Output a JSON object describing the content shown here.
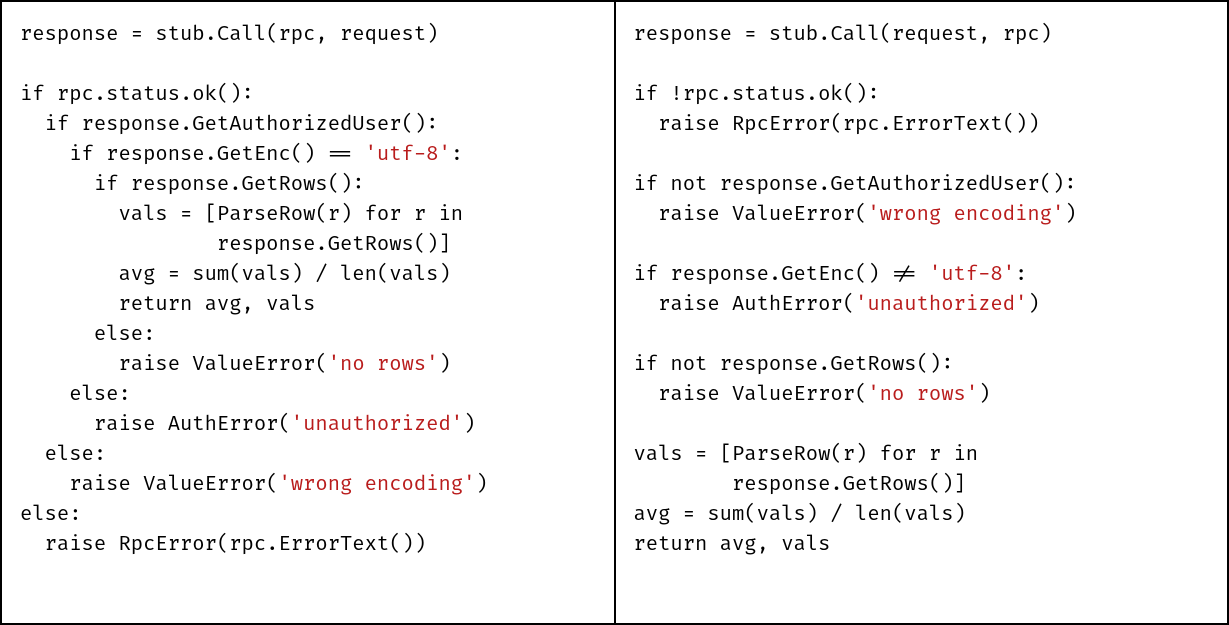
{
  "left": {
    "l1": "response = stub.Call(rpc, request)",
    "l2": "",
    "l3": "if rpc.status.ok():",
    "l4": "  if response.GetAuthorizedUser():",
    "l5a": "    if response.GetEnc() == ",
    "l5s": "'utf-8'",
    "l5b": ":",
    "l6": "      if response.GetRows():",
    "l7": "        vals = [ParseRow(r) for r in",
    "l8": "                response.GetRows()]",
    "l9": "        avg = sum(vals) / len(vals)",
    "l10": "        return avg, vals",
    "l11": "      else:",
    "l12a": "        raise ValueError(",
    "l12s": "'no rows'",
    "l12b": ")",
    "l13": "    else:",
    "l14a": "      raise AuthError(",
    "l14s": "'unauthorized'",
    "l14b": ")",
    "l15": "  else:",
    "l16a": "    raise ValueError(",
    "l16s": "'wrong encoding'",
    "l16b": ")",
    "l17": "else:",
    "l18": "  raise RpcError(rpc.ErrorText())"
  },
  "right": {
    "r1": "response = stub.Call(request, rpc)",
    "r2": "",
    "r3": "if !rpc.status.ok():",
    "r4": "  raise RpcError(rpc.ErrorText())",
    "r5": "",
    "r6": "if not response.GetAuthorizedUser():",
    "r7a": "  raise ValueError(",
    "r7s": "'wrong encoding'",
    "r7b": ")",
    "r8": "",
    "r9a": "if response.GetEnc() != ",
    "r9s": "'utf-8'",
    "r9b": ":",
    "r10a": "  raise AuthError(",
    "r10s": "'unauthorized'",
    "r10b": ")",
    "r11": "",
    "r12": "if not response.GetRows():",
    "r13a": "  raise ValueError(",
    "r13s": "'no rows'",
    "r13b": ")",
    "r14": "",
    "r15": "vals = [ParseRow(r) for r in",
    "r16": "        response.GetRows()]",
    "r17": "avg = sum(vals) / len(vals)",
    "r18": "return avg, vals"
  }
}
